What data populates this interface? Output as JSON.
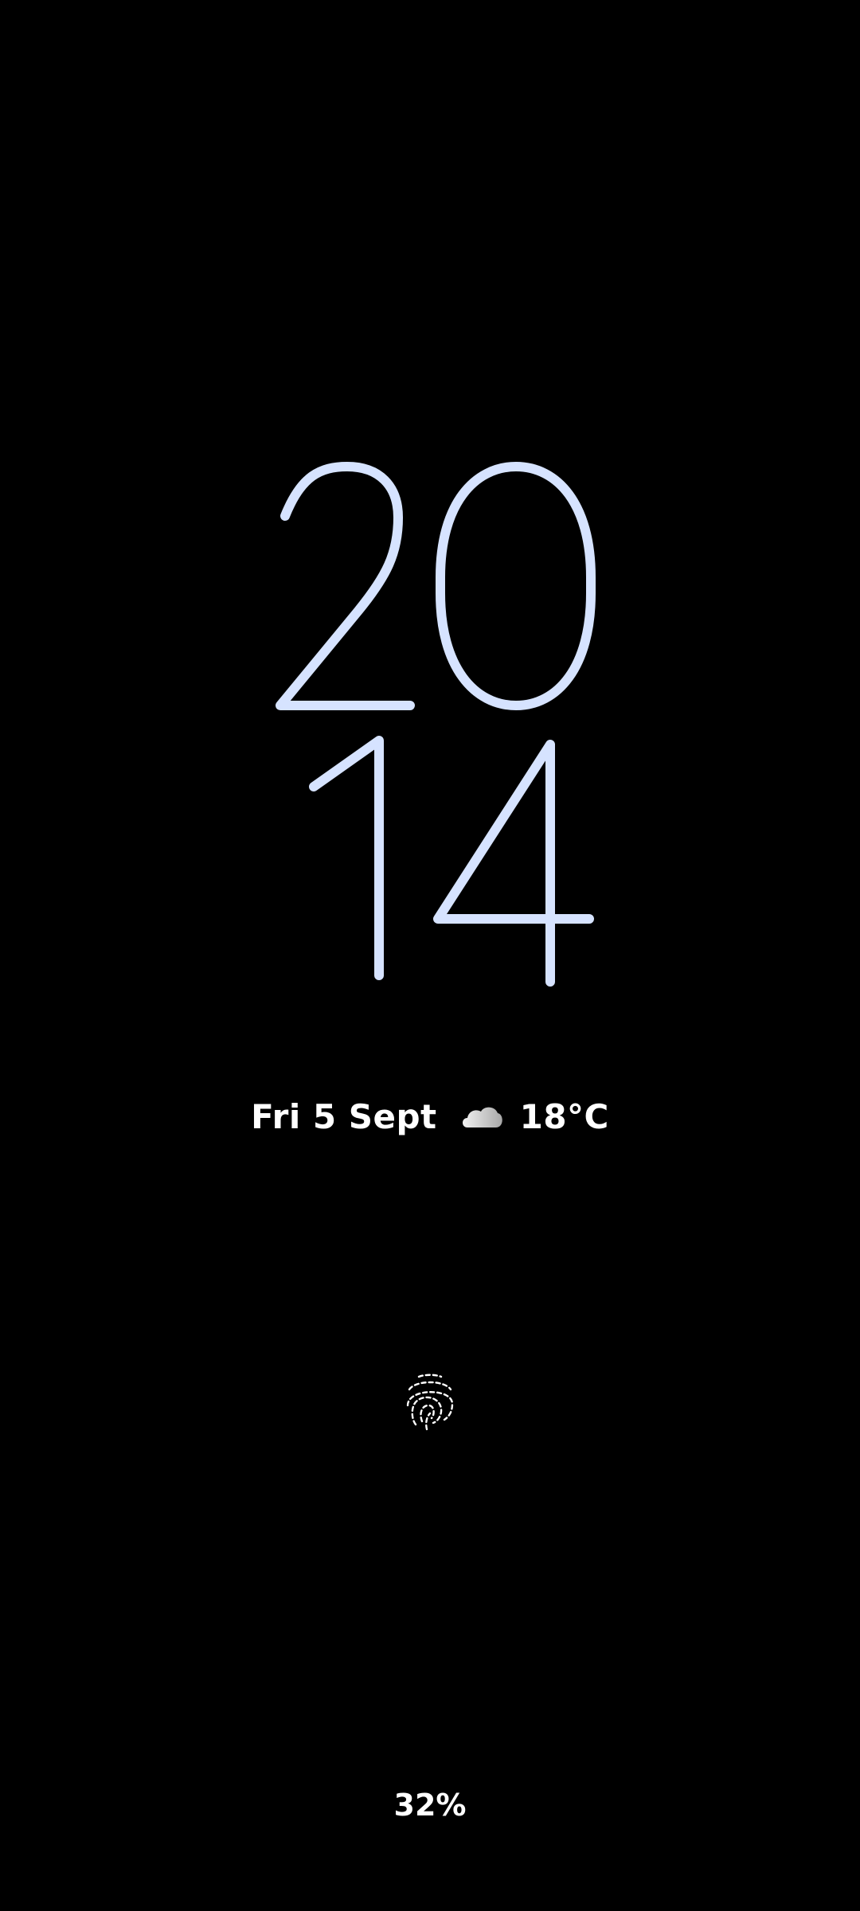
{
  "clock": {
    "hours": "20",
    "minutes": "14",
    "color": "#D6E3FF"
  },
  "date": {
    "label": "Fri 5 Sept"
  },
  "weather": {
    "icon": "cloud-icon",
    "temperature": "18°C"
  },
  "fingerprint": {
    "icon": "fingerprint-icon"
  },
  "battery": {
    "label": "32%"
  }
}
